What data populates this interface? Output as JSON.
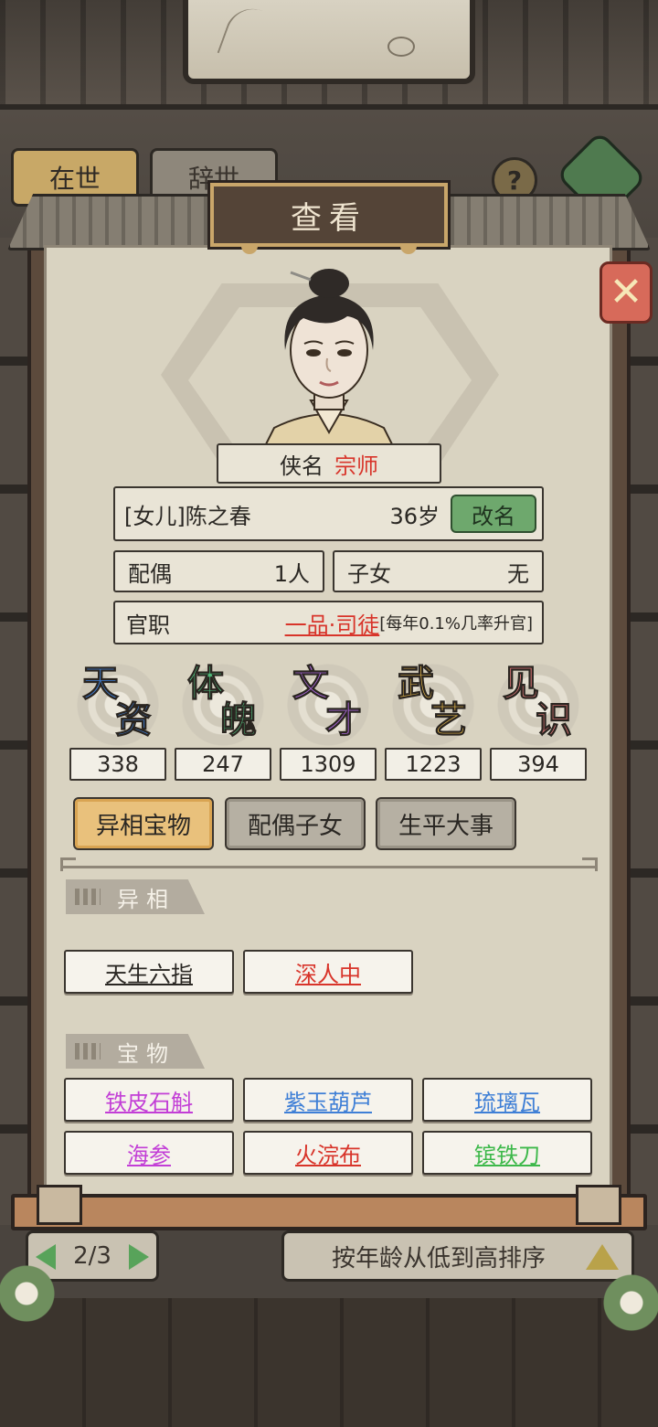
{
  "background": {
    "tab_alive": "在世",
    "tab_dead": "辞世",
    "help_label": "?",
    "pager": "2/3",
    "sort_label": "按年龄从低到高排序"
  },
  "dialog": {
    "title": "查看",
    "close_icon": "close-x-icon"
  },
  "hero": {
    "title_label": "侠名",
    "title_value": "宗师",
    "name": "[女儿]陈之春",
    "age": "36岁",
    "rename_label": "改名",
    "spouse_label": "配偶",
    "spouse_value": "1人",
    "children_label": "子女",
    "children_value": "无",
    "official_label": "官职",
    "official_value": "一品·司徒",
    "official_note": "[每年0.1%几率升官]"
  },
  "attributes": [
    {
      "c1": "天",
      "c2": "资",
      "value": "338",
      "color": "#3f7fd6"
    },
    {
      "c1": "体",
      "c2": "魄",
      "value": "247",
      "color": "#4fb879"
    },
    {
      "c1": "文",
      "c2": "才",
      "value": "1309",
      "color": "#a766d6"
    },
    {
      "c1": "武",
      "c2": "艺",
      "value": "1223",
      "color": "#e3b64a"
    },
    {
      "c1": "见",
      "c2": "识",
      "value": "394",
      "color": "#e07a7a"
    }
  ],
  "tabs": [
    {
      "label": "异相宝物",
      "active": true
    },
    {
      "label": "配偶子女",
      "active": false
    },
    {
      "label": "生平大事",
      "active": false
    }
  ],
  "traits_section": {
    "header": "异相",
    "items": [
      {
        "label": "天生六指",
        "color": "#2a2723"
      },
      {
        "label": "深人中",
        "color": "#d8342a"
      }
    ]
  },
  "treasures_section": {
    "header": "宝物",
    "items": [
      {
        "label": "铁皮石斛",
        "color": "#c23ed6"
      },
      {
        "label": "紫玉葫芦",
        "color": "#3f7fd6"
      },
      {
        "label": "琉璃瓦",
        "color": "#3f7fd6"
      },
      {
        "label": "海参",
        "color": "#c23ed6"
      },
      {
        "label": "火浣布",
        "color": "#d8342a"
      },
      {
        "label": "镔铁刀",
        "color": "#3db84a"
      }
    ]
  }
}
